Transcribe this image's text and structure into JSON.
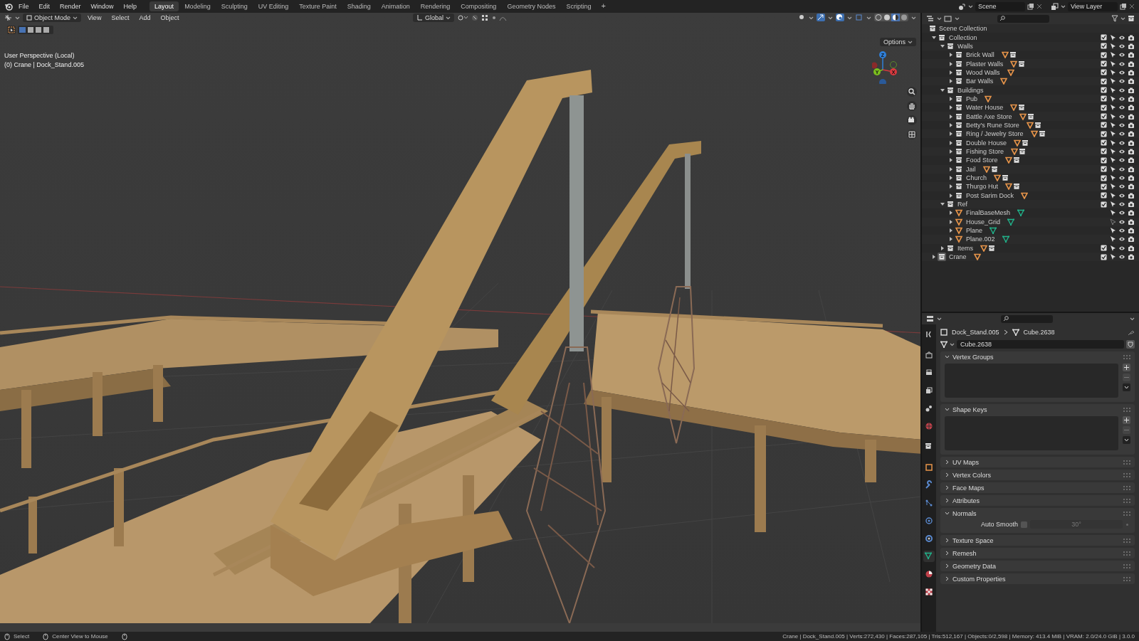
{
  "topbar": {
    "menus": [
      "File",
      "Edit",
      "Render",
      "Window",
      "Help"
    ],
    "workspaces": [
      {
        "label": "Layout",
        "selected": true
      },
      {
        "label": "Modeling",
        "selected": false
      },
      {
        "label": "Sculpting",
        "selected": false
      },
      {
        "label": "UV Editing",
        "selected": false
      },
      {
        "label": "Texture Paint",
        "selected": false
      },
      {
        "label": "Shading",
        "selected": false
      },
      {
        "label": "Animation",
        "selected": false
      },
      {
        "label": "Rendering",
        "selected": false
      },
      {
        "label": "Compositing",
        "selected": false
      },
      {
        "label": "Geometry Nodes",
        "selected": false
      },
      {
        "label": "Scripting",
        "selected": false
      }
    ],
    "add_workspace": "+",
    "scene": "Scene",
    "view_layer": "View Layer"
  },
  "viewport": {
    "mode": "Object Mode",
    "menus": [
      "View",
      "Select",
      "Add",
      "Object"
    ],
    "orientation": "Global",
    "options": "Options",
    "view_name": "User Perspective (Local)",
    "active_info": "(0) Crane | Dock_Stand.005",
    "gizmo": [
      {
        "label": "Z",
        "color": "#2f7fd8"
      },
      {
        "label": "Y",
        "color": "#7bbf1e"
      },
      {
        "label": "X",
        "color": "#d8393f"
      }
    ]
  },
  "outliner": {
    "root": "Scene Collection",
    "tree": [
      {
        "name": "Collection",
        "kind": "collection",
        "checked": true,
        "expanded": true,
        "selectable": true,
        "selected": false,
        "children": [
          {
            "name": "Walls",
            "kind": "collection",
            "checked": true,
            "expanded": true,
            "selectable": true,
            "selected": false,
            "children": [
              {
                "name": "Brick Wall",
                "kind": "collection",
                "checked": true,
                "expanded": false,
                "selectable": true,
                "selected": false,
                "badges": [
                  {
                    "kind": "mesh"
                  },
                  {
                    "kind": "collection"
                  }
                ]
              },
              {
                "name": "Plaster Walls",
                "kind": "collection",
                "checked": true,
                "expanded": false,
                "selectable": true,
                "selected": false,
                "badges": [
                  {
                    "kind": "mesh"
                  },
                  {
                    "kind": "collection"
                  }
                ]
              },
              {
                "name": "Wood Walls",
                "kind": "collection",
                "checked": true,
                "expanded": false,
                "selectable": true,
                "selected": false,
                "badges": [
                  {
                    "kind": "mesh"
                  }
                ]
              },
              {
                "name": "Bar Walls",
                "kind": "collection",
                "checked": true,
                "expanded": false,
                "selectable": true,
                "selected": false,
                "badges": [
                  {
                    "kind": "mesh"
                  }
                ]
              }
            ]
          },
          {
            "name": "Buildings",
            "kind": "collection",
            "checked": true,
            "expanded": true,
            "selectable": true,
            "selected": false,
            "children": [
              {
                "name": "Pub",
                "kind": "collection",
                "checked": true,
                "expanded": false,
                "selectable": true,
                "selected": false,
                "badges": [
                  {
                    "kind": "mesh"
                  }
                ]
              },
              {
                "name": "Water House",
                "kind": "collection",
                "checked": true,
                "expanded": false,
                "selectable": true,
                "selected": false,
                "badges": [
                  {
                    "kind": "mesh"
                  },
                  {
                    "kind": "collection"
                  }
                ]
              },
              {
                "name": "Battle Axe Store",
                "kind": "collection",
                "checked": true,
                "expanded": false,
                "selectable": true,
                "selected": false,
                "badges": [
                  {
                    "kind": "mesh"
                  },
                  {
                    "kind": "collection"
                  }
                ]
              },
              {
                "name": "Betty's Rune Store",
                "kind": "collection",
                "checked": true,
                "expanded": false,
                "selectable": true,
                "selected": false,
                "badges": [
                  {
                    "kind": "mesh"
                  },
                  {
                    "kind": "collection"
                  }
                ]
              },
              {
                "name": "Ring / Jewelry Store",
                "kind": "collection",
                "checked": true,
                "expanded": false,
                "selectable": true,
                "selected": false,
                "badges": [
                  {
                    "kind": "mesh"
                  },
                  {
                    "kind": "collection"
                  }
                ]
              },
              {
                "name": "Double House",
                "kind": "collection",
                "checked": true,
                "expanded": false,
                "selectable": true,
                "selected": false,
                "badges": [
                  {
                    "kind": "mesh"
                  },
                  {
                    "kind": "collection"
                  }
                ]
              },
              {
                "name": "Fishing Store",
                "kind": "collection",
                "checked": true,
                "expanded": false,
                "selectable": true,
                "selected": false,
                "badges": [
                  {
                    "kind": "mesh"
                  },
                  {
                    "kind": "collection"
                  }
                ]
              },
              {
                "name": "Food Store",
                "kind": "collection",
                "checked": true,
                "expanded": false,
                "selectable": true,
                "selected": false,
                "badges": [
                  {
                    "kind": "mesh"
                  },
                  {
                    "kind": "collection"
                  }
                ]
              },
              {
                "name": "Jail",
                "kind": "collection",
                "checked": true,
                "expanded": false,
                "selectable": true,
                "selected": false,
                "badges": [
                  {
                    "kind": "mesh"
                  },
                  {
                    "kind": "collection"
                  }
                ]
              },
              {
                "name": "Church",
                "kind": "collection",
                "checked": true,
                "expanded": false,
                "selectable": true,
                "selected": false,
                "badges": [
                  {
                    "kind": "mesh"
                  },
                  {
                    "kind": "collection"
                  }
                ]
              },
              {
                "name": "Thurgo Hut",
                "kind": "collection",
                "checked": true,
                "expanded": false,
                "selectable": true,
                "selected": false,
                "badges": [
                  {
                    "kind": "mesh"
                  },
                  {
                    "kind": "collection"
                  }
                ]
              },
              {
                "name": "Post Sarim Dock",
                "kind": "collection",
                "checked": true,
                "expanded": false,
                "selectable": true,
                "selected": false,
                "badges": [
                  {
                    "kind": "mesh"
                  }
                ]
              }
            ]
          },
          {
            "name": "Ref",
            "kind": "collection",
            "checked": true,
            "expanded": true,
            "selectable": true,
            "selected": false,
            "children": [
              {
                "name": "FinalBaseMesh",
                "kind": "object",
                "expanded": false,
                "selectable": true,
                "selected": false,
                "badges": [
                  {
                    "kind": "mesh-data"
                  }
                ]
              },
              {
                "name": "House_Grid",
                "kind": "object",
                "expanded": false,
                "selectable": false,
                "selected": false,
                "badges": [
                  {
                    "kind": "mesh-data"
                  }
                ]
              },
              {
                "name": "Plane",
                "kind": "object",
                "expanded": false,
                "selectable": true,
                "selected": false,
                "badges": [
                  {
                    "kind": "mesh-data"
                  }
                ]
              },
              {
                "name": "Plane.002",
                "kind": "object",
                "expanded": false,
                "selectable": true,
                "selected": false,
                "badges": [
                  {
                    "kind": "mesh-data"
                  }
                ]
              }
            ]
          },
          {
            "name": "Items",
            "kind": "collection",
            "checked": true,
            "expanded": false,
            "selectable": true,
            "selected": false,
            "badges": [
              {
                "kind": "mesh"
              },
              {
                "kind": "collection"
              }
            ]
          }
        ]
      },
      {
        "name": "Crane",
        "kind": "collection",
        "checked": true,
        "expanded": false,
        "selectable": true,
        "selected": true,
        "badges": [
          {
            "kind": "mesh"
          }
        ]
      }
    ]
  },
  "properties": {
    "breadcrumb": [
      "Dock_Stand.005",
      "Cube.2638"
    ],
    "mesh_name": "Cube.2638",
    "tabs": [
      {
        "kind": "tool",
        "selected": false
      },
      {
        "kind": "render",
        "selected": false
      },
      {
        "kind": "output",
        "selected": false
      },
      {
        "kind": "view-layer",
        "selected": false
      },
      {
        "kind": "scene",
        "selected": false
      },
      {
        "kind": "world",
        "selected": false
      },
      {
        "kind": "collection",
        "selected": false
      },
      {
        "kind": "object",
        "selected": false
      },
      {
        "kind": "modifier",
        "selected": false
      },
      {
        "kind": "particles",
        "selected": false
      },
      {
        "kind": "physics",
        "selected": false
      },
      {
        "kind": "constraints",
        "selected": false
      },
      {
        "kind": "data",
        "selected": true
      },
      {
        "kind": "material",
        "selected": false
      },
      {
        "kind": "texture",
        "selected": false
      }
    ],
    "panels": [
      {
        "title": "Vertex Groups",
        "kind": "list",
        "expanded": true
      },
      {
        "title": "Shape Keys",
        "kind": "list",
        "expanded": true
      },
      {
        "title": "UV Maps",
        "expanded": false
      },
      {
        "title": "Vertex Colors",
        "expanded": false
      },
      {
        "title": "Face Maps",
        "expanded": false
      },
      {
        "title": "Attributes",
        "expanded": false
      },
      {
        "title": "Normals",
        "kind": "normals",
        "expanded": true,
        "label": "Auto Smooth",
        "checked": false,
        "value": "30°"
      },
      {
        "title": "Texture Space",
        "expanded": false
      },
      {
        "title": "Remesh",
        "expanded": false
      },
      {
        "title": "Geometry Data",
        "expanded": false
      },
      {
        "title": "Custom Properties",
        "expanded": false
      }
    ]
  },
  "status_bar": {
    "hints": [
      "Select",
      "Center View to Mouse"
    ],
    "stats": "Crane | Dock_Stand.005 | Verts:272,430 | Faces:287,105 | Tris:512,167 | Objects:0/2,598 | Memory: 413.4 MiB | VRAM: 2.0/24.0 GiB | 3.0.0"
  }
}
